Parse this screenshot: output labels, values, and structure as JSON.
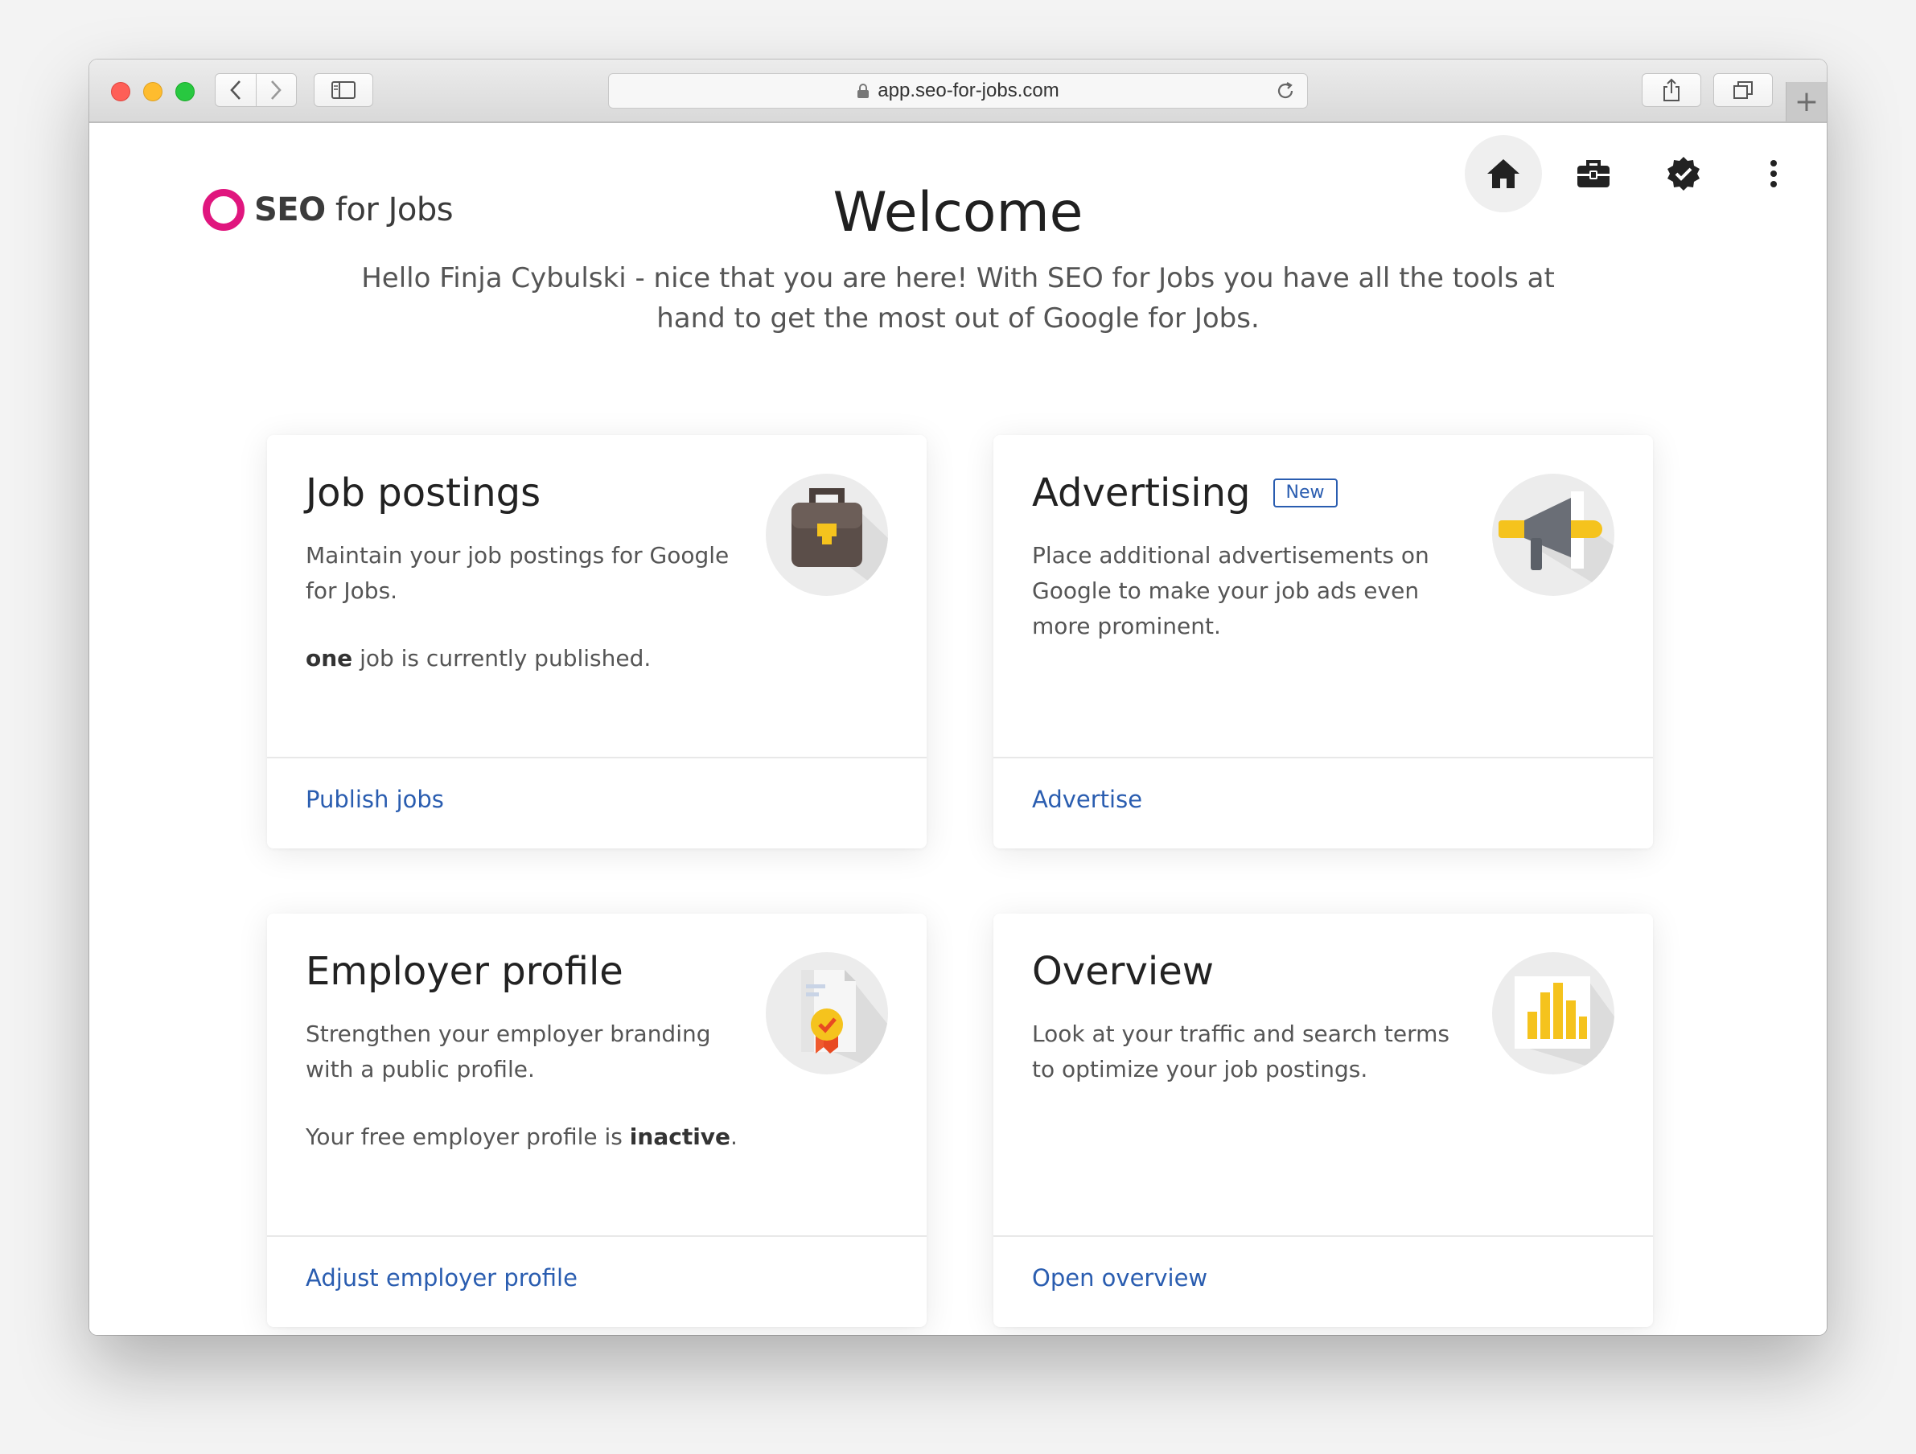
{
  "browser": {
    "url": "app.seo-for-jobs.com",
    "new_tab": "+"
  },
  "header": {
    "logo_bold": "SEO",
    "logo_rest": " for Jobs",
    "title": "Welcome",
    "intro": "Hello Finja Cybulski - nice that you are here! With SEO for Jobs you have all the tools at hand to get the most out of Google for Jobs."
  },
  "nav": {
    "icons": [
      "home-icon",
      "briefcase-icon",
      "verified-badge-icon",
      "more-vert-icon"
    ]
  },
  "cards": {
    "jobs": {
      "title": "Job postings",
      "desc": "Maintain your job postings for Google for Jobs.",
      "status_bold": "one",
      "status_rest": " job is currently published.",
      "link": "Publish jobs"
    },
    "advertising": {
      "title": "Advertising",
      "badge": "New",
      "desc": "Place additional advertisements on Google to make your job ads even more prominent.",
      "link": "Advertise"
    },
    "employer": {
      "title": "Employer profile",
      "desc": "Strengthen your employer branding with a public profile.",
      "status_pre": "Your free employer profile is ",
      "status_bold": "inactive",
      "status_post": ".",
      "link": "Adjust employer profile"
    },
    "overview": {
      "title": "Overview",
      "desc": "Look at your traffic and search terms to optimize your job postings.",
      "link": "Open overview"
    }
  },
  "colors": {
    "brand": "#e0167e",
    "link": "#2a5db0",
    "icon_yellow": "#f5c31d",
    "icon_brown": "#5b4e49"
  }
}
